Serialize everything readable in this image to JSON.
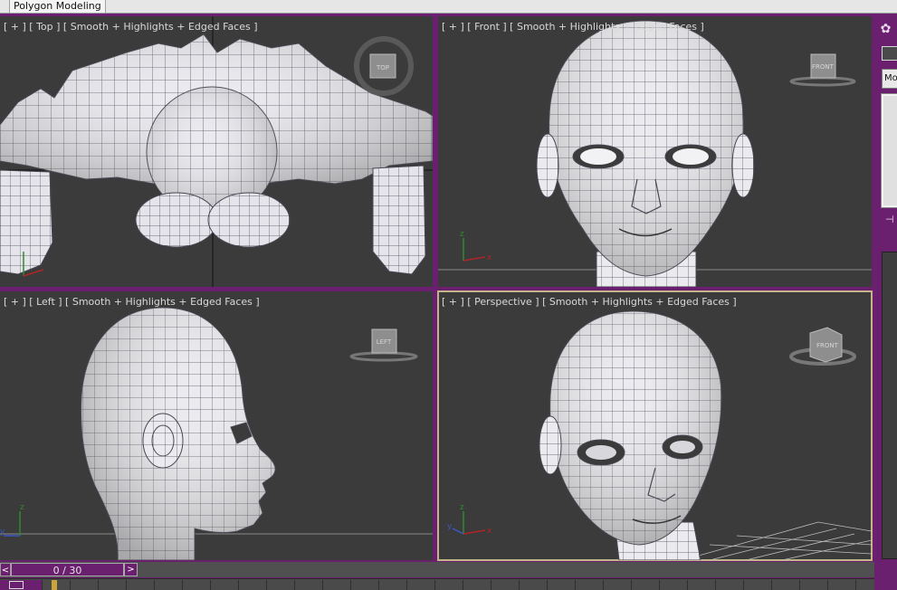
{
  "ribbon": {
    "active_tab": "Polygon Modeling"
  },
  "viewports": {
    "top": {
      "label": "[ + ] [ Top ] [ Smooth + Highlights + Edged Faces ]",
      "viewcube": "TOP"
    },
    "front": {
      "label": "[ + ] [ Front ] [ Smooth + Highlights + Edged Faces ]",
      "viewcube": "FRONT"
    },
    "left": {
      "label": "[ + ] [ Left ] [ Smooth + Highlights + Edged Faces ]",
      "viewcube": "LEFT"
    },
    "perspective": {
      "label": "[ + ] [ Perspective ] [ Smooth + Highlights + Edged Faces ]",
      "viewcube": "FRONT"
    }
  },
  "command_panel": {
    "modifier_dropdown": "Mo"
  },
  "time_slider": {
    "frame_display": "0 / 30",
    "prev": "<",
    "next": ">"
  },
  "axis_labels": {
    "x": "x",
    "y": "y",
    "z": "z"
  },
  "colors": {
    "ui_accent": "#6b1f6f",
    "viewport_bg": "#3b3b3b",
    "active_border": "#c4b48a",
    "mesh_fill": "#ececef",
    "wire": "#4a4553"
  }
}
